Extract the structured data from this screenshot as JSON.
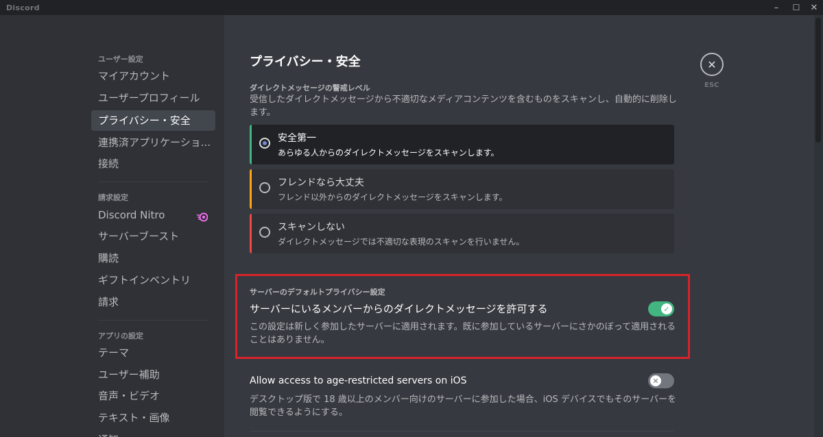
{
  "app": {
    "name": "Discord",
    "window_controls": {
      "minimize": "–",
      "maximize": "☐",
      "close": "✕"
    }
  },
  "sidebar": {
    "sections": [
      {
        "header": "ユーザー設定",
        "items": [
          "マイアカウント",
          "ユーザープロフィール",
          "プライバシー・安全",
          "連携済アプリケーショ...",
          "接続"
        ]
      },
      {
        "header": "請求設定",
        "items": [
          "Discord Nitro",
          "サーバーブースト",
          "購読",
          "ギフトインベントリ",
          "請求"
        ]
      },
      {
        "header": "アプリの設定",
        "items": [
          "テーマ",
          "ユーザー補助",
          "音声・ビデオ",
          "テキスト・画像",
          "通知"
        ]
      }
    ],
    "selected_item": "プライバシー・安全",
    "icons": {
      "nitro": "nitro-icon"
    }
  },
  "main": {
    "title": "プライバシー・安全",
    "esc_label": "ESC",
    "dm_filter": {
      "label": "ダイレクトメッセージの警戒レベル",
      "description": "受信したダイレクトメッセージから不適切なメディアコンテンツを含むものをスキャンし、自動的に削除します。",
      "options": [
        {
          "title": "安全第一",
          "subtitle": "あらゆる人からのダイレクトメッセージをスキャンします。",
          "selected": true,
          "accent": "#43b581"
        },
        {
          "title": "フレンドなら大丈夫",
          "subtitle": "フレンド以外からのダイレクトメッセージをスキャンします。",
          "selected": false,
          "accent": "#faa61a"
        },
        {
          "title": "スキャンしない",
          "subtitle": "ダイレクトメッセージでは不適切な表現のスキャンを行いません。",
          "selected": false,
          "accent": "#f04747"
        }
      ]
    },
    "server_privacy": {
      "label": "サーバーのデフォルトプライバシー設定",
      "toggle_title": "サーバーにいるメンバーからのダイレクトメッセージを許可する",
      "toggle_on": true,
      "description": "この設定は新しく参加したサーバーに適用されます。既に参加しているサーバーにさかのぼって適用されることはありません。",
      "highlight_color": "#d9232b"
    },
    "age_restricted": {
      "toggle_title": "Allow access to age-restricted servers on iOS",
      "toggle_on": false,
      "description": "デスクトップ版で 18 歳以上のメンバー向けのサーバーに参加した場合、iOS デバイスでもそのサーバーを閲覧できるようにする。"
    }
  },
  "colors": {
    "toggle_on": "#43b581",
    "toggle_off": "#72767d",
    "selected_radio": "#7289da"
  }
}
